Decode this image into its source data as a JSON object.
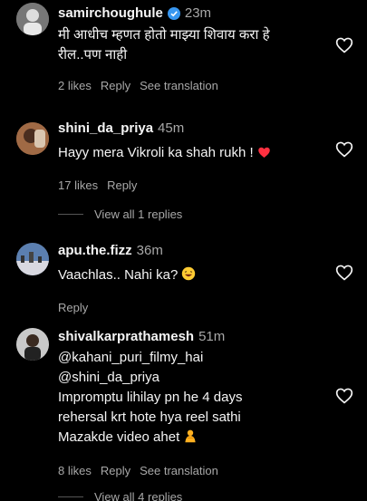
{
  "comments": [
    {
      "username": "samirchoughule",
      "verified": true,
      "time": "23m",
      "lines": [
        "मी आधीच म्हणत होतो माझ्या शिवाय करा हे",
        "रील..पण नाही"
      ],
      "likes": "2 likes",
      "reply": "Reply",
      "translation": "See translation"
    },
    {
      "username": "shini_da_priya",
      "time": "45m",
      "lines": [
        "Hayy mera Vikroli ka shah rukh !"
      ],
      "emoji": "red-heart",
      "likes": "17 likes",
      "reply": "Reply",
      "view_replies": "View all 1 replies"
    },
    {
      "username": "apu.the.fizz",
      "time": "36m",
      "lines": [
        "Vaachlas.. Nahi ka?"
      ],
      "emoji": "laughing-face",
      "reply": "Reply"
    },
    {
      "username": "shivalkarprathamesh",
      "time": "51m",
      "lines": [
        "@kahani_puri_filmy_hai",
        "@shini_da_priya",
        "Impromptu lihilay pn he 4 days",
        "rehersal krt hote hya reel sathi",
        "Mazakde video ahet"
      ],
      "emoji": "person-bowing",
      "likes": "8 likes",
      "reply": "Reply",
      "translation": "See translation",
      "view_replies": "View all 4 replies"
    }
  ],
  "colors": {
    "background": "#000000",
    "text": "#f5f5f5",
    "muted": "#a8a8a8",
    "verified": "#3897f0",
    "red_heart": "#ff3040"
  }
}
